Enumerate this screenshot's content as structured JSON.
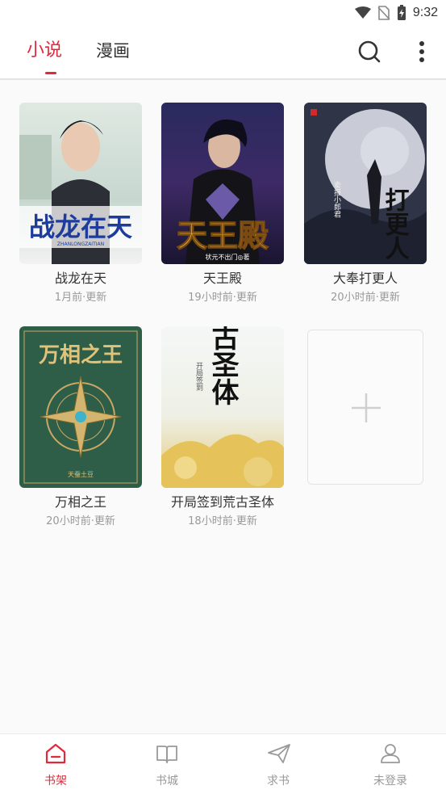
{
  "status_bar": {
    "time": "9:32",
    "icons": [
      "wifi-icon",
      "sim-off-icon",
      "battery-charging-icon"
    ]
  },
  "header": {
    "tabs": [
      {
        "label": "小说",
        "active": true
      },
      {
        "label": "漫画",
        "active": false
      }
    ],
    "actions": [
      "search-icon",
      "more-vertical-icon"
    ]
  },
  "bookshelf": {
    "books": [
      {
        "title": "战龙在天",
        "updated": "1月前·更新",
        "cover_text": "战龙在天",
        "cover_subtext": "ZHANLONGZAITIAN"
      },
      {
        "title": "天王殿",
        "updated": "19小时前·更新",
        "cover_text": "天王殿",
        "cover_subtext": "状元不出门◎著"
      },
      {
        "title": "大奉打更人",
        "updated": "20小时前·更新",
        "cover_text": "打更人",
        "cover_subtext": "卖报小郎君"
      },
      {
        "title": "万相之王",
        "updated": "20小时前·更新",
        "cover_text": "万相之王",
        "cover_subtext": "天蚕土豆"
      },
      {
        "title": "开局签到荒古圣体",
        "updated": "18小时前·更新",
        "cover_text": "荒古圣体",
        "cover_subtext": "开局签到"
      }
    ],
    "add_icon": "plus-icon"
  },
  "bottom_nav": [
    {
      "label": "书架",
      "icon": "home-icon",
      "active": true
    },
    {
      "label": "书城",
      "icon": "book-open-icon",
      "active": false
    },
    {
      "label": "求书",
      "icon": "send-icon",
      "active": false
    },
    {
      "label": "未登录",
      "icon": "user-icon",
      "active": false
    }
  ],
  "colors": {
    "accent": "#e3283b",
    "inactive": "#999999",
    "background": "#fafafa"
  }
}
